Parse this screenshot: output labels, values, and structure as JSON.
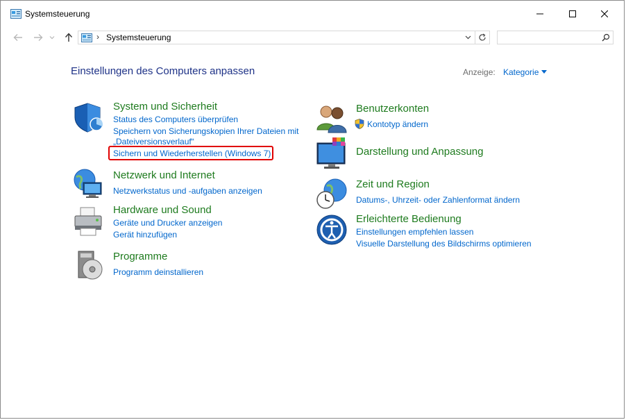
{
  "window": {
    "title": "Systemsteuerung"
  },
  "address": {
    "separator": "›",
    "path": "Systemsteuerung"
  },
  "content": {
    "heading": "Einstellungen des Computers anpassen",
    "view_label": "Anzeige:",
    "view_value": "Kategorie"
  },
  "categories": {
    "system": {
      "title": "System und Sicherheit",
      "links": [
        "Status des Computers überprüfen",
        "Speichern von Sicherungskopien Ihrer Dateien mit",
        "„Dateiversionsverlauf“",
        "Sichern und Wiederherstellen (Windows 7)"
      ]
    },
    "network": {
      "title": "Netzwerk und Internet",
      "links": [
        "Netzwerkstatus und -aufgaben anzeigen"
      ]
    },
    "hardware": {
      "title": "Hardware und Sound",
      "links": [
        "Geräte und Drucker anzeigen",
        "Gerät hinzufügen"
      ]
    },
    "programs": {
      "title": "Programme",
      "links": [
        "Programm deinstallieren"
      ]
    },
    "users": {
      "title": "Benutzerkonten",
      "links": [
        "Kontotyp ändern"
      ]
    },
    "appearance": {
      "title": "Darstellung und Anpassung",
      "links": []
    },
    "clock": {
      "title": "Zeit und Region",
      "links": [
        "Datums-, Uhrzeit- oder Zahlenformat ändern"
      ]
    },
    "ease": {
      "title": "Erleichterte Bedienung",
      "links": [
        "Einstellungen empfehlen lassen",
        "Visuelle Darstellung des Bildschirms optimieren"
      ]
    }
  },
  "colors": {
    "category_title": "#1e7b1e",
    "link": "#0066cc",
    "heading": "#1e3287",
    "highlight_border": "#e00000"
  }
}
